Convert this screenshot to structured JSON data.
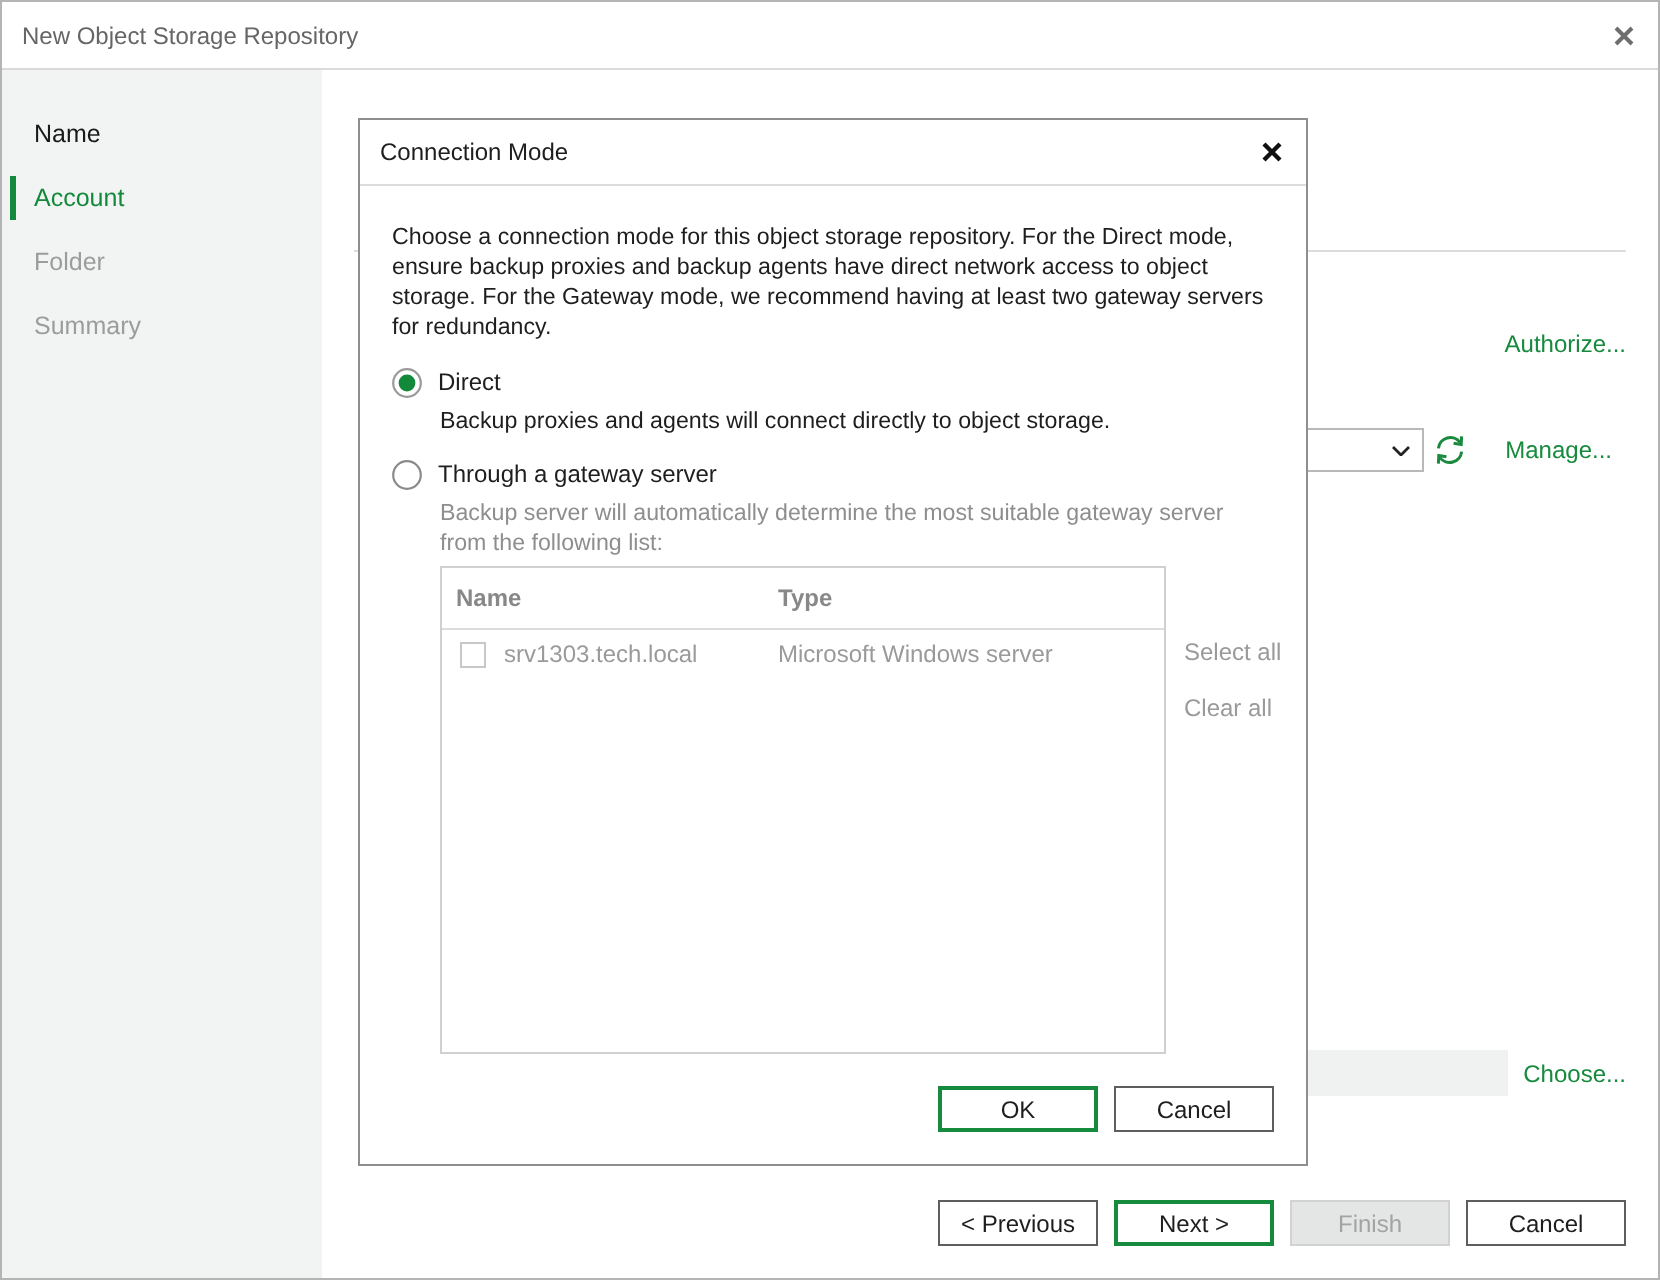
{
  "window": {
    "title": "New Object Storage Repository"
  },
  "sidebar": {
    "items": [
      {
        "label": "Name",
        "selected": false,
        "disabled": false
      },
      {
        "label": "Account",
        "selected": true,
        "disabled": false
      },
      {
        "label": "Folder",
        "selected": false,
        "disabled": true
      },
      {
        "label": "Summary",
        "selected": false,
        "disabled": true
      }
    ]
  },
  "account_page": {
    "authorize_link": "Authorize...",
    "manage_link": "Manage...",
    "choose_link": "Choose..."
  },
  "wizard_buttons": [
    {
      "label": "< Previous",
      "default": false,
      "disabled": false
    },
    {
      "label": "Next >",
      "default": true,
      "disabled": false
    },
    {
      "label": "Finish",
      "default": false,
      "disabled": true
    },
    {
      "label": "Cancel",
      "default": false,
      "disabled": false
    }
  ],
  "dialog": {
    "title": "Connection Mode",
    "description": "Choose a connection mode for this object storage repository. For the Direct mode, ensure backup proxies and backup agents have direct network access to object storage. For the Gateway mode, we recommend having at least two gateway servers for redundancy.",
    "options": [
      {
        "label": "Direct",
        "description": "Backup proxies and agents will connect directly to object storage.",
        "selected": true
      },
      {
        "label": "Through a gateway server",
        "description": "Backup server will automatically determine the most suitable gateway server from the following list:",
        "selected": false,
        "server_list": {
          "disabled": true,
          "columns": [
            "Name",
            "Type"
          ],
          "rows": [
            {
              "checked": false,
              "cells": [
                "srv1303.tech.local",
                "Microsoft Windows server"
              ]
            }
          ],
          "actions": [
            "Select all",
            "Clear all"
          ]
        }
      }
    ],
    "buttons": [
      {
        "label": "OK",
        "default": true
      },
      {
        "label": "Cancel",
        "default": false
      }
    ]
  }
}
